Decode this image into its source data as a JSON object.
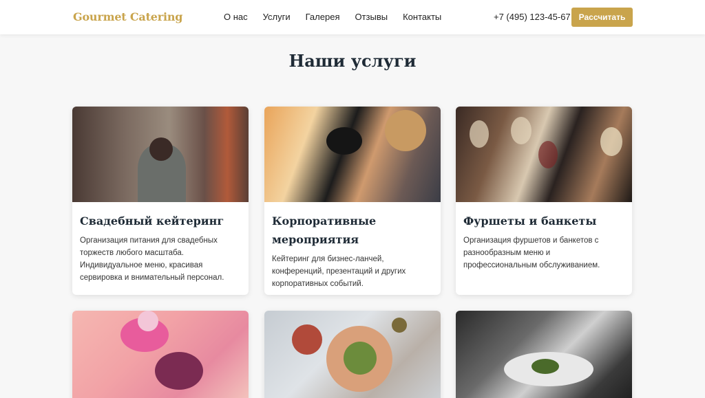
{
  "brand": {
    "name": "Gourmet Catering",
    "accent": "#c9a44c"
  },
  "nav": [
    {
      "label": "О нас"
    },
    {
      "label": "Услуги"
    },
    {
      "label": "Галерея"
    },
    {
      "label": "Отзывы"
    },
    {
      "label": "Контакты"
    }
  ],
  "header": {
    "phone": "+7 (495) 123-45-67",
    "cta_label": "Рассчитать"
  },
  "services": {
    "title": "Наши услуги",
    "cards": [
      {
        "title": "Свадебный кейтеринг",
        "description": "Организация питания для свадебных торжеств любого масштаба. Индивидуальное меню, красивая сервировка и внимательный персонал."
      },
      {
        "title": "Корпоративные мероприятия",
        "description": "Кейтеринг для бизнес-ланчей, конференций, презентаций и других корпоративных событий."
      },
      {
        "title": "Фуршеты и банкеты",
        "description": "Организация фуршетов и банкетов с разнообразным меню и профессиональным обслуживанием."
      },
      {
        "title": "",
        "description": ""
      },
      {
        "title": "",
        "description": ""
      },
      {
        "title": "",
        "description": ""
      }
    ]
  }
}
